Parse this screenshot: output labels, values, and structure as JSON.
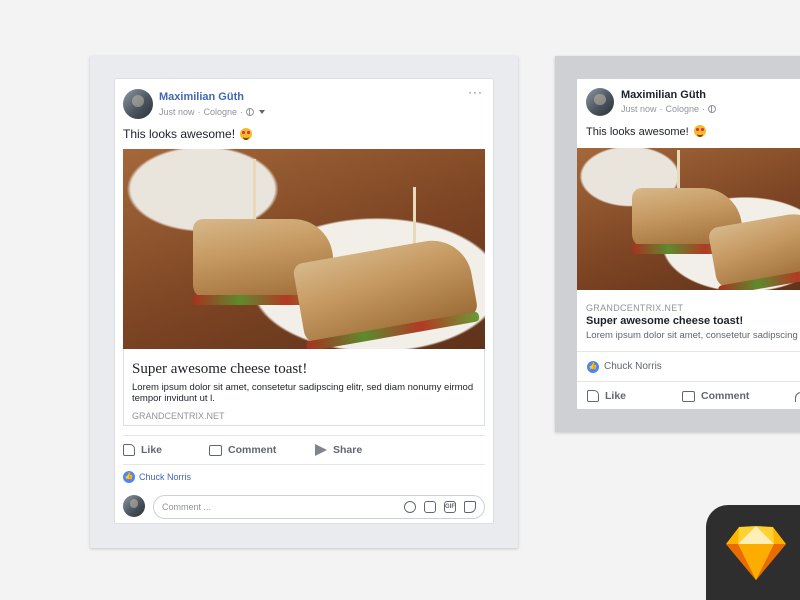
{
  "colors": {
    "link_blue": "#4267b2",
    "like_blue": "#4a86f5",
    "sketch_orange": "#f7a72c"
  },
  "post_desktop": {
    "author": "Maximilian Güth",
    "time": "Just now",
    "separator": "·",
    "location": "Cologne",
    "more": "···",
    "status_text": "This looks awesome!",
    "link": {
      "title": "Super awesome cheese toast!",
      "description": "Lorem ipsum dolor sit amet, consetetur sadipscing elitr, sed diam nonumy eirmod tempor invidunt ut l.",
      "domain": "GRANDCENTRIX.NET"
    },
    "actions": {
      "like": "Like",
      "comment": "Comment",
      "share": "Share"
    },
    "liked_by": "Chuck Norris",
    "comment_placeholder": "Comment ...",
    "comment_icons": [
      "smiley-icon",
      "camera-icon",
      "gif-icon",
      "sticker-icon"
    ],
    "gif_label": "GIF"
  },
  "post_mobile": {
    "author": "Maximilian Güth",
    "time": "Just now",
    "separator": "·",
    "location": "Cologne",
    "status_text": "This looks awesome!",
    "link": {
      "domain": "GRANDCENTRIX.NET",
      "title": "Super awesome cheese toast!",
      "description": "Lorem ipsum dolor sit amet, consetetur sadipscing elitr,"
    },
    "liked_by": "Chuck Norris",
    "actions": {
      "like": "Like",
      "comment": "Comment"
    }
  },
  "badge": {
    "icon": "sketch-diamond-icon"
  }
}
